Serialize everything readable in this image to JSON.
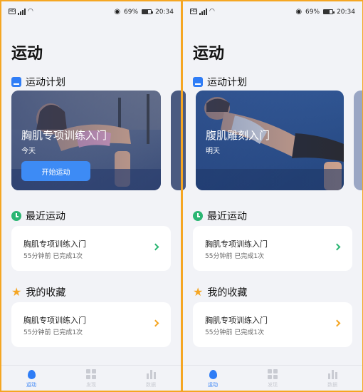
{
  "screens": [
    {
      "status": {
        "left": "HD",
        "battery": "69%",
        "time": "20:34"
      },
      "page_title": "运动",
      "plan_section": "运动计划",
      "plan_card": {
        "title": "胸肌专项训练入门",
        "subtitle": "今天",
        "button": "开始运动"
      },
      "recent_section": "最近运动",
      "recent_item": {
        "title": "胸肌专项训练入门",
        "meta": "55分钟前 已完成1次"
      },
      "fav_section": "我的收藏",
      "fav_item": {
        "title": "胸肌专项训练入门",
        "meta": "55分钟前 已完成1次"
      },
      "tabs": [
        "运动",
        "发现",
        "数据"
      ]
    },
    {
      "status": {
        "left": "HD",
        "battery": "69%",
        "time": "20:34"
      },
      "page_title": "运动",
      "plan_section": "运动计划",
      "plan_card": {
        "title": "腹肌雕刻入门",
        "subtitle": "明天"
      },
      "recent_section": "最近运动",
      "recent_item": {
        "title": "胸肌专项训练入门",
        "meta": "55分钟前 已完成1次"
      },
      "fav_section": "我的收藏",
      "fav_item": {
        "title": "胸肌专项训练入门",
        "meta": "55分钟前 已完成1次"
      },
      "tabs": [
        "运动",
        "发现",
        "数据"
      ]
    }
  ],
  "colors": {
    "frame_border": "#f5a623",
    "accent_blue": "#2f7df6",
    "recent_chevron": "#2bb673",
    "fav_chevron": "#f5a623",
    "tab_active": "#2f7df6",
    "tab_inactive": "#c9cbd2"
  },
  "icons": [
    "sim-icon",
    "signal-icon",
    "wifi-icon",
    "eye-icon",
    "battery-icon",
    "plan-icon",
    "clock-icon",
    "star-icon",
    "chevron-right-icon",
    "drop-icon",
    "grid-icon",
    "bar-chart-icon"
  ]
}
